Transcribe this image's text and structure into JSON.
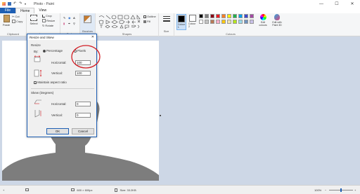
{
  "window": {
    "title": "Photo - Paint",
    "minimize": "—",
    "maximize": "☐",
    "close": "✕"
  },
  "menu": {
    "file": "File",
    "home": "Home",
    "view": "View"
  },
  "ribbon": {
    "clipboard": {
      "label": "Clipboard",
      "paste": "Paste",
      "cut": "Cut",
      "copy": "Copy"
    },
    "image": {
      "label": "Image",
      "select": "Select",
      "crop": "Crop",
      "resize": "Resize",
      "rotate": "Rotate"
    },
    "tools": {
      "label": "Tools"
    },
    "brushes": {
      "label": "Brushes"
    },
    "shapes": {
      "label": "Shapes",
      "outline": "Outline",
      "fill": "Fill"
    },
    "size": {
      "label": "Size"
    },
    "colours": {
      "label": "Colours",
      "colour1": "Colour 1",
      "colour2": "Colour 2",
      "edit": "Edit colours",
      "paint3d": "Edit with Paint 3D",
      "palette": [
        "#000000",
        "#7f7f7f",
        "#880015",
        "#ed1c24",
        "#ff7f27",
        "#fff200",
        "#22b14c",
        "#00a2e8",
        "#3f48cc",
        "#a349a4",
        "#ffffff",
        "#c3c3c3",
        "#b97a57",
        "#ffaec9",
        "#ffc90e",
        "#efe4b0",
        "#b5e61d",
        "#99d9ea",
        "#7092be",
        "#c8bfe7"
      ]
    }
  },
  "dialog": {
    "title": "Resize and Skew",
    "close": "✕",
    "resize_label": "Resize",
    "by_label": "By:",
    "percentage": "Percentage",
    "pixels": "Pixels",
    "horizontal_label": "Horizontal:",
    "horizontal_value": "100",
    "vertical_label": "Vertical:",
    "vertical_value": "100",
    "maintain_aspect": "Maintain aspect ratio",
    "skew_label": "Skew (Degrees)",
    "skew_horizontal_label": "Horizontal:",
    "skew_horizontal_value": "0",
    "skew_vertical_label": "Vertical:",
    "skew_vertical_value": "0",
    "ok": "OK",
    "cancel": "Cancel",
    "selected_unit": "Percentage",
    "maintain_checked": true
  },
  "status": {
    "dimensions": "600 × 600px",
    "size": "Size: 33.2KB",
    "zoom": "100%",
    "zoom_level": 100
  },
  "colors": {
    "accent": "#1e5fb4",
    "annotation": "#d21f26",
    "silhouette": "#7d7d7d"
  }
}
